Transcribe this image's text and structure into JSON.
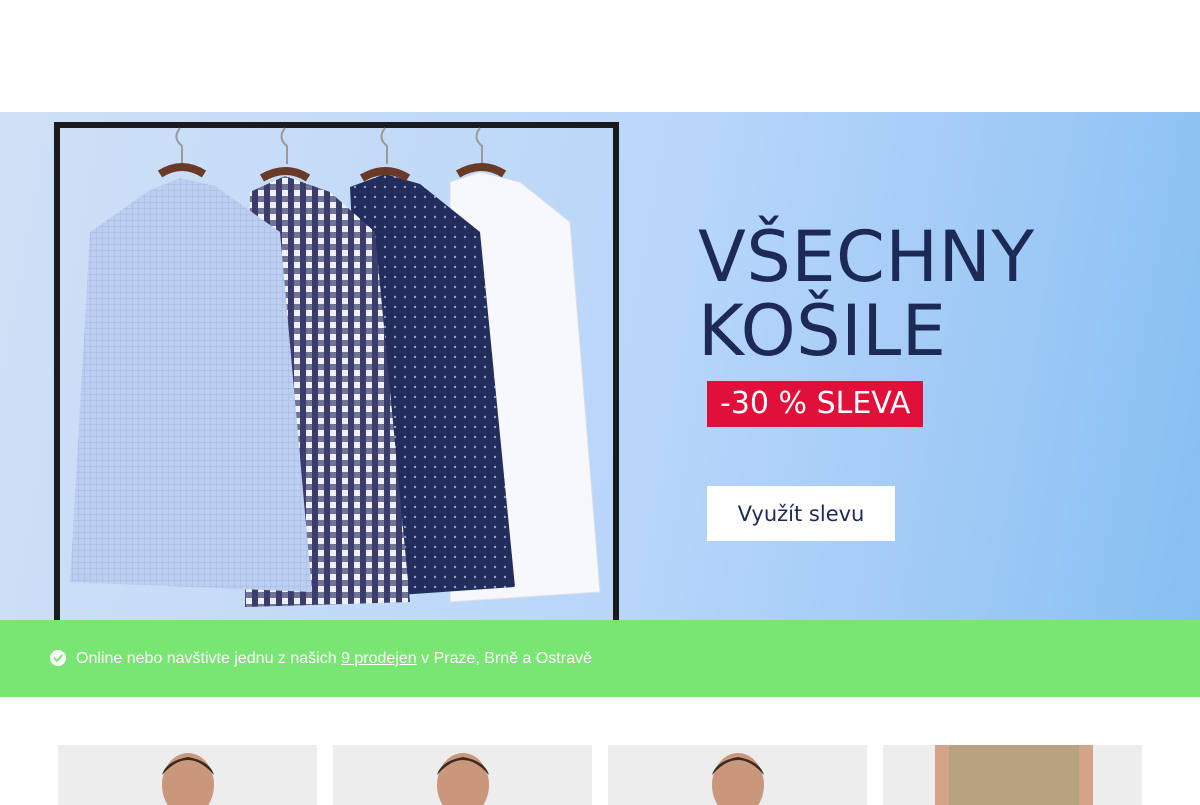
{
  "hero": {
    "title_line1": "VŠECHNY",
    "title_line2": "KOŠILE",
    "badge": "-30 % SLEVA",
    "cta_label": "Využít slevu",
    "colors": {
      "title": "#1c2a55",
      "badge_bg": "#e1103a",
      "cta_bg": "#ffffff"
    }
  },
  "info_bar": {
    "before": "Online nebo navštivte jednu z našich ",
    "link": "9 prodejen",
    "after": " v Praze, Brně a Ostravě",
    "icon": "check-circle-icon",
    "colors": {
      "bg": "#79e673",
      "text": "#ffffff"
    }
  },
  "products": {
    "cards": [
      {
        "name": "product-card-1"
      },
      {
        "name": "product-card-2"
      },
      {
        "name": "product-card-3"
      },
      {
        "name": "product-card-4"
      }
    ]
  }
}
